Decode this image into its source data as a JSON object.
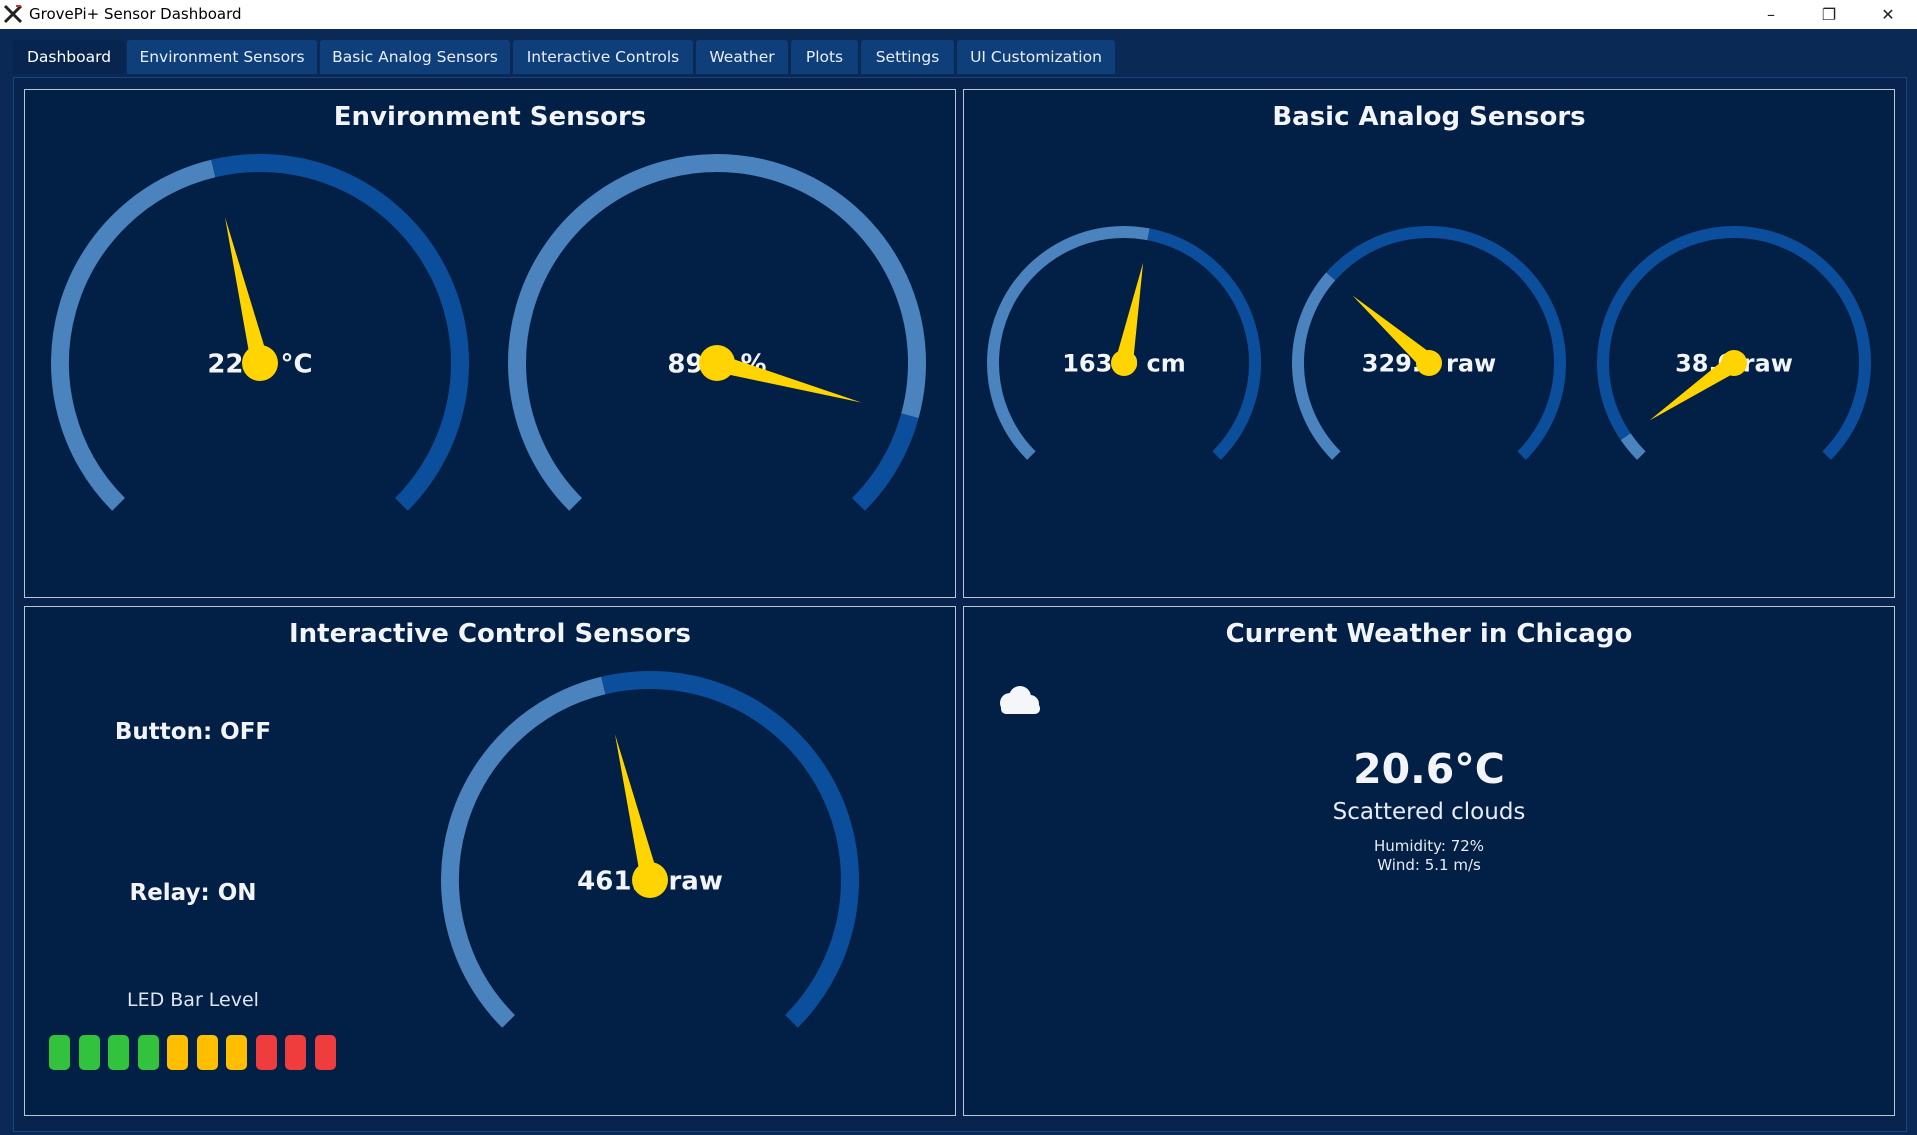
{
  "window": {
    "title": "GrovePi+ Sensor Dashboard",
    "controls": [
      "–",
      "❐",
      "✕"
    ]
  },
  "tabs": [
    {
      "label": "Dashboard",
      "active": true
    },
    {
      "label": "Environment Sensors"
    },
    {
      "label": "Basic Analog Sensors"
    },
    {
      "label": "Interactive Controls"
    },
    {
      "label": "Weather"
    },
    {
      "label": "Plots"
    },
    {
      "label": "Settings"
    },
    {
      "label": "UI Customization"
    }
  ],
  "panels": {
    "environment": {
      "title": "Environment Sensors",
      "gauges": [
        {
          "label": "22.0 °C",
          "fraction": 0.45
        },
        {
          "label": "89.0 %",
          "fraction": 0.89
        }
      ]
    },
    "analog": {
      "title": "Basic Analog Sensors",
      "gauges": [
        {
          "label": "163.0 cm",
          "fraction": 0.54
        },
        {
          "label": "329.0 raw",
          "fraction": 0.32
        },
        {
          "label": "38.0 raw",
          "fraction": 0.04
        }
      ]
    },
    "interactive": {
      "title": "Interactive Control Sensors",
      "button": "Button: OFF",
      "relay": "Relay: ON",
      "led_label": "LED Bar Level",
      "led_colors": [
        "#33c23d",
        "#33c23d",
        "#33c23d",
        "#33c23d",
        "#ffbf00",
        "#ffbf00",
        "#ffbf00",
        "#ef3d3d",
        "#ef3d3d",
        "#ef3d3d"
      ],
      "gauge": {
        "label": "461.0 raw",
        "fraction": 0.45
      }
    },
    "weather": {
      "title": "Current Weather in Chicago",
      "icon": "cloud-icon",
      "temperature": "20.6°C",
      "description": "Scattered clouds",
      "humidity": "Humidity: 72%",
      "wind": "Wind: 5.1 m/s"
    }
  },
  "colors": {
    "gauge_light": "#4a83bd",
    "gauge_dark": "#0b4f9c",
    "needle": "#ffd400",
    "panel_bg": "#021f45",
    "window_bg": "#0a2a55"
  }
}
